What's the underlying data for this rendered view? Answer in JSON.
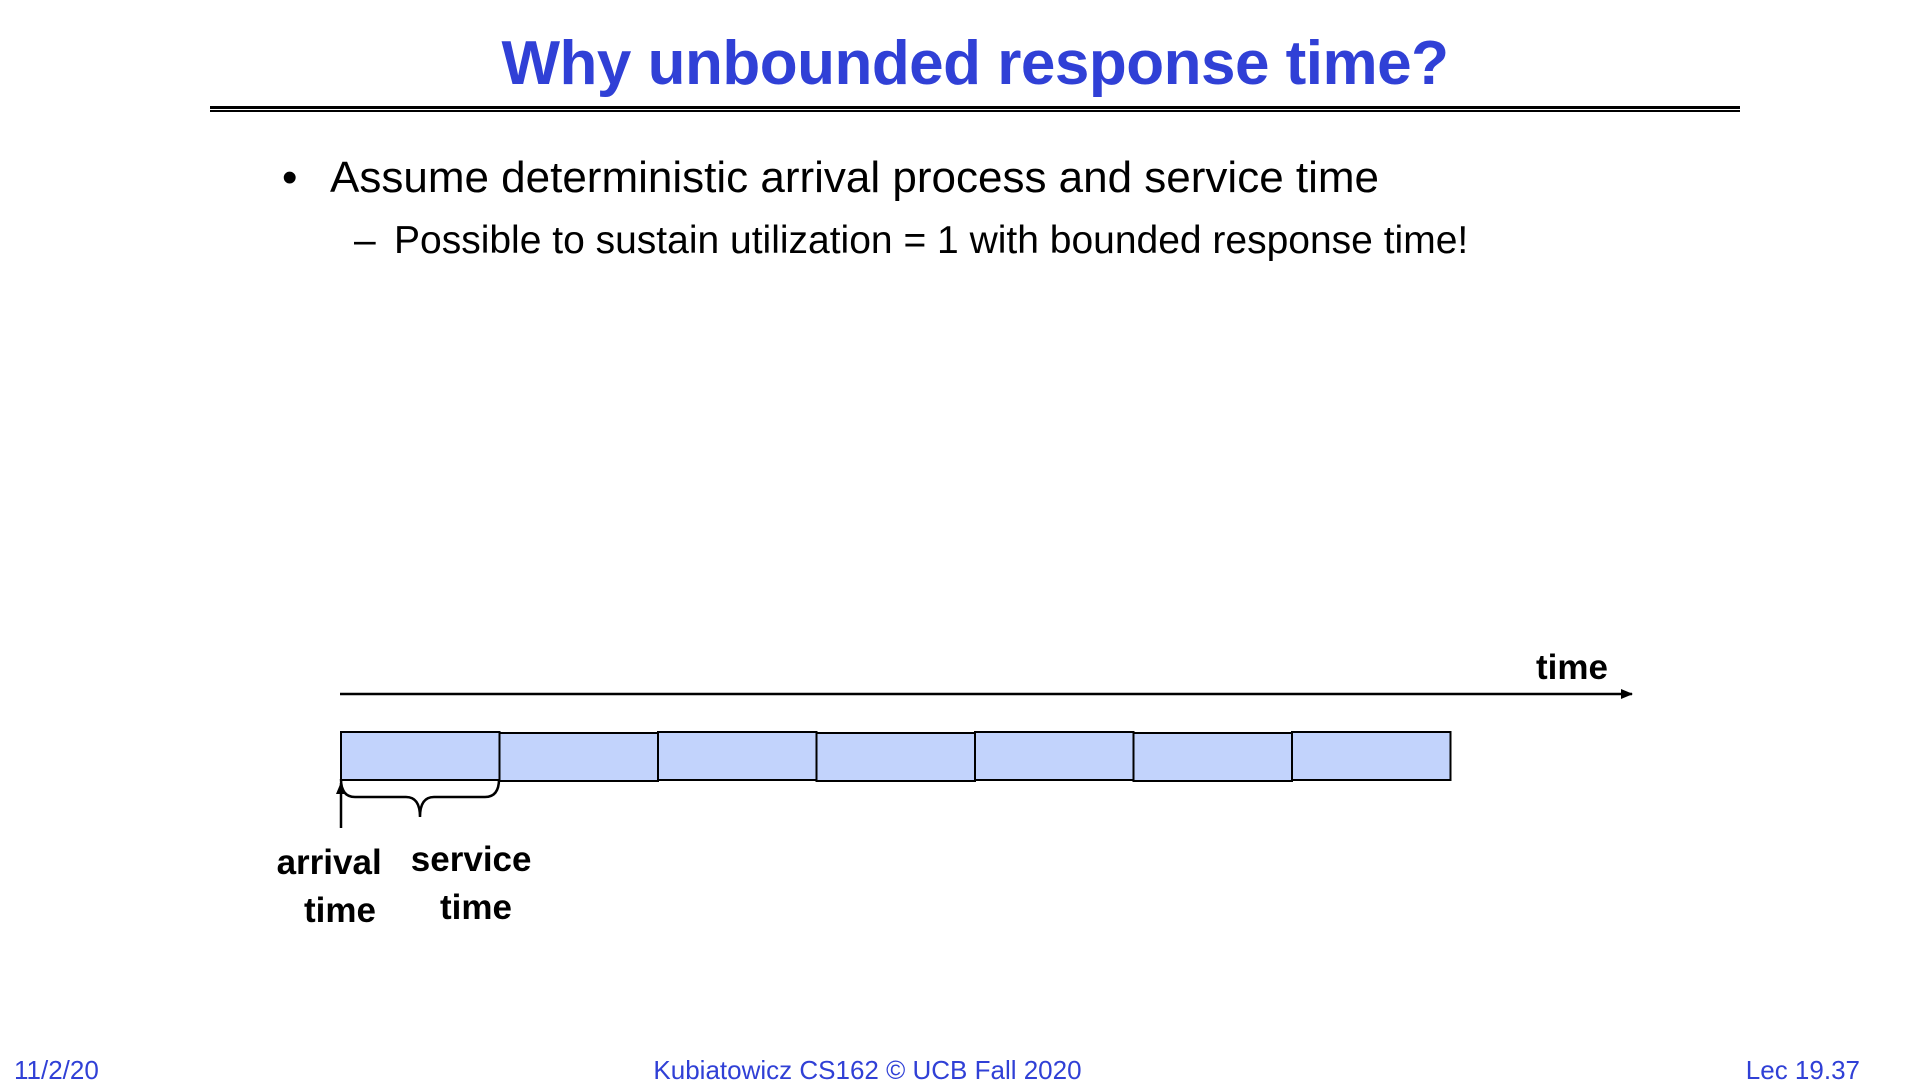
{
  "slide": {
    "title": "Why unbounded response time?",
    "bullets": [
      {
        "marker": "•",
        "text": "Assume deterministic arrival process and service time",
        "sub": [
          {
            "marker": "–",
            "text": "Possible to sustain utilization = 1 with bounded response time!"
          }
        ]
      }
    ]
  },
  "diagram": {
    "axis_label": "time",
    "box_count": 7,
    "box_color": "#c2d3fc",
    "label_arrival": [
      "arrival",
      "time"
    ],
    "label_service": [
      "service",
      "time"
    ]
  },
  "footer": {
    "date": "11/2/20",
    "course": "Kubiatowicz CS162 © UCB Fall 2020",
    "lecture": "Lec 19.37"
  },
  "colors": {
    "accent": "#3040d6"
  }
}
